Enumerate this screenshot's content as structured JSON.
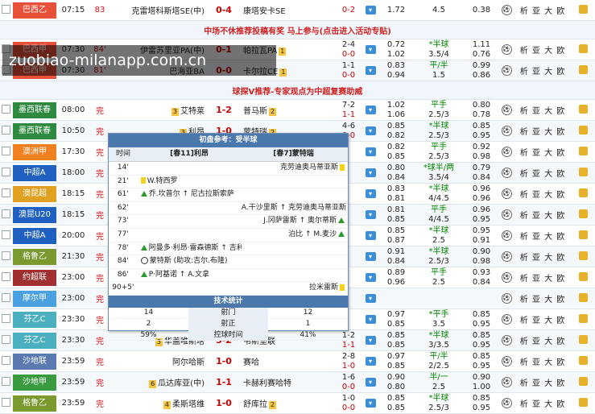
{
  "watermark": "zuobiao-milanapp.com.cn",
  "promo1": "中场不休推荐投稿有奖 马上参与(点击进入活动专贴)",
  "promo2": "球探V推荐-专家观点为中超复赛助威",
  "links_label": "析 亚 大 欧",
  "top_rows": [
    {
      "league": "巴西乙",
      "league_color": "#e8503a",
      "time": "07:15",
      "status": "83",
      "home": "克雷塔科斯塔SE(中)",
      "score": "0-4",
      "away": "康塔安卡SE",
      "half": "0-2",
      "o1": "1.72",
      "o2": "4.5",
      "o3": "0.38"
    }
  ],
  "mid_rows": [
    {
      "league": "巴西甲",
      "league_color": "#e8503a",
      "time": "07:30",
      "status": "84'",
      "home": "伊雷苏里亚PA(中)",
      "home_rank": "",
      "score": "0-1",
      "away": "帕拉瓦PA",
      "away_rank": "1",
      "half_a": "2-4",
      "half_b": "0-0",
      "oa1": "0.72",
      "oa2": "*半球",
      "oa3": "1.11",
      "ob1": "1.02",
      "ob2": "3.5/4",
      "ob3": "0.76"
    },
    {
      "league": "巴西甲",
      "league_color": "#e8503a",
      "time": "07:30",
      "status": "81'",
      "home": "巴海亚BA",
      "home_rank": "",
      "score": "0-0",
      "away": "卡尔拉CE",
      "away_rank": "1",
      "half_a": "1-1",
      "half_b": "0-0",
      "oa1": "0.83",
      "oa2": "平/半",
      "oa3": "0.99",
      "ob1": "0.94",
      "ob2": "1.5",
      "ob3": "0.86"
    }
  ],
  "rows": [
    {
      "league": "墨西联春",
      "league_color": "#2d8a3e",
      "time": "08:00",
      "status": "完",
      "home": "艾特莱",
      "home_rank": "3",
      "score": "1-2",
      "away": "普马斯",
      "away_rank": "2",
      "half_a": "7-2",
      "half_b": "1-1",
      "oa1": "1.02",
      "oa2": "平手",
      "oa3": "0.80",
      "ob1": "1.06",
      "ob2": "2.5/3",
      "ob3": "0.78"
    },
    {
      "league": "墨西联春",
      "league_color": "#2d8a3e",
      "time": "10:50",
      "status": "完",
      "home": "利昂",
      "home_rank": "3",
      "score": "1-0",
      "away": "蒙特瑞",
      "away_rank": "2",
      "half_a": "4-6",
      "half_b": "0-0",
      "oa1": "0.85",
      "oa2": "*半球",
      "oa3": "0.85",
      "ob1": "0.82",
      "ob2": "2.5/3",
      "ob3": "0.95"
    },
    {
      "league": "澳洲甲",
      "league_color": "#f08020",
      "time": "17:30",
      "status": "完",
      "home": "",
      "home_rank": "",
      "score": "",
      "away": "",
      "away_rank": "",
      "half_a": "",
      "half_b": "",
      "oa1": "0.82",
      "oa2": "平手",
      "oa3": "0.92",
      "ob1": "0.85",
      "ob2": "2.5/3",
      "ob3": "0.98"
    },
    {
      "league": "中超A",
      "league_color": "#2060c0",
      "time": "18:00",
      "status": "完",
      "home": "",
      "home_rank": "",
      "score": "",
      "away": "",
      "away_rank": "",
      "half_a": "",
      "half_b": "",
      "oa1": "0.80",
      "oa2": "*球半/两",
      "oa3": "0.79",
      "ob1": "0.84",
      "ob2": "3.5/4",
      "ob3": "0.84"
    },
    {
      "league": "澳昆超",
      "league_color": "#e0a020",
      "time": "18:15",
      "status": "完",
      "home": "",
      "home_rank": "",
      "score": "",
      "away": "",
      "away_rank": "",
      "half_a": "",
      "half_b": "",
      "oa1": "0.83",
      "oa2": "*半球",
      "oa3": "0.96",
      "ob1": "0.81",
      "ob2": "4/4.5",
      "ob3": "0.96"
    },
    {
      "league": "澳昆U20",
      "league_color": "#2060c0",
      "time": "18:15",
      "status": "完",
      "home": "",
      "home_rank": "",
      "score": "",
      "away": "",
      "away_rank": "",
      "half_a": "",
      "half_b": "",
      "oa1": "0.81",
      "oa2": "平手",
      "oa3": "0.96",
      "ob1": "0.85",
      "ob2": "4/4.5",
      "ob3": "0.95"
    },
    {
      "league": "中超A",
      "league_color": "#2060c0",
      "time": "20:00",
      "status": "完",
      "home": "",
      "home_rank": "",
      "score": "",
      "away": "",
      "away_rank": "",
      "half_a": "",
      "half_b": "",
      "oa1": "0.85",
      "oa2": "*半球",
      "oa3": "0.95",
      "ob1": "0.87",
      "ob2": "2.5",
      "ob3": "0.91"
    },
    {
      "league": "格鲁乙",
      "league_color": "#7a9a30",
      "time": "21:30",
      "status": "完",
      "home": "",
      "home_rank": "",
      "score": "",
      "away": "",
      "away_rank": "",
      "half_a": "",
      "half_b": "",
      "oa1": "0.91",
      "oa2": "*半球",
      "oa3": "0.90",
      "ob1": "0.84",
      "ob2": "2.5/3",
      "ob3": "0.98"
    },
    {
      "league": "约超联",
      "league_color": "#a03030",
      "time": "23:00",
      "status": "完",
      "home": "",
      "home_rank": "",
      "score": "",
      "away": "",
      "away_rank": "",
      "half_a": "",
      "half_b": "",
      "oa1": "0.89",
      "oa2": "平手",
      "oa3": "0.93",
      "ob1": "0.96",
      "ob2": "2.5",
      "ob3": "0.84"
    },
    {
      "league": "摩尔甲",
      "league_color": "#4aa0e0",
      "time": "23:00",
      "status": "完",
      "home": "",
      "home_rank": "",
      "score": "",
      "away": "",
      "away_rank": "",
      "half_a": "",
      "half_b": "",
      "oa1": "",
      "oa2": "",
      "oa3": "",
      "ob1": "",
      "ob2": "",
      "ob3": ""
    },
    {
      "league": "芬乙C",
      "league_color": "#4ab0c0",
      "time": "23:30",
      "status": "完",
      "home": "",
      "home_rank": "",
      "score": "",
      "away": "",
      "away_rank": "",
      "half_a": "",
      "half_b": "",
      "oa1": "0.97",
      "oa2": "*平手",
      "oa3": "0.85",
      "ob1": "0.85",
      "ob2": "3.5",
      "ob3": "0.95"
    },
    {
      "league": "芬乙C",
      "league_color": "#4ab0c0",
      "time": "23:30",
      "status": "完",
      "home": "华盖唯斯塔",
      "home_rank": "3",
      "score": "3-2",
      "away": "韦斯堡联",
      "away_rank": "",
      "half_a": "1-2",
      "half_b": "1-1",
      "oa1": "0.85",
      "oa2": "*半球",
      "oa3": "0.85",
      "ob1": "0.85",
      "ob2": "3/3.5",
      "ob3": "0.95"
    },
    {
      "league": "沙地联",
      "league_color": "#5a7ab0",
      "time": "23:59",
      "status": "完",
      "home": "阿尔哈斯",
      "home_rank": "",
      "score": "1-0",
      "away": "赛哈",
      "away_rank": "",
      "half_a": "2-8",
      "half_b": "1-0",
      "oa1": "0.97",
      "oa2": "平/半",
      "oa3": "0.85",
      "ob1": "0.85",
      "ob2": "2/2.5",
      "ob3": "0.95"
    },
    {
      "league": "沙地甲",
      "league_color": "#3a9a40",
      "time": "23:59",
      "status": "完",
      "home": "瓜达库亚(中)",
      "home_rank": "6",
      "score": "1-1",
      "away": "卡赫利赛哈特",
      "away_rank": "",
      "half_a": "1-6",
      "half_b": "0-0",
      "oa1": "0.90",
      "oa2": "半/一",
      "oa3": "0.90",
      "ob1": "0.80",
      "ob2": "2.5",
      "ob3": "1.00"
    },
    {
      "league": "格鲁乙",
      "league_color": "#7a9a30",
      "time": "23:59",
      "status": "完",
      "home": "柔斯塔维",
      "home_rank": "4",
      "score": "1-0",
      "away": "舒库拉",
      "away_rank": "2",
      "half_a": "1-0",
      "half_b": "0-0",
      "oa1": "0.85",
      "oa2": "*半球",
      "oa3": "0.85",
      "ob1": "0.85",
      "ob2": "2.5/3",
      "ob3": "0.95"
    }
  ],
  "popup": {
    "title": "初盘参考：受半球",
    "col_time": "时间",
    "home": "[春11]利昂",
    "away": "[春7]蒙特瑞",
    "events": [
      {
        "t": "14'",
        "h": "",
        "hi": "",
        "a": "克劳迪奥马蒂亚斯",
        "ai": "yc"
      },
      {
        "t": "21'",
        "h": "W.特西罗",
        "hi": "yc",
        "a": "",
        "ai": ""
      },
      {
        "t": "61'",
        "h": "乔.坎普尔 ↑ 尼古拉斯索萨",
        "hi": "up",
        "a": "",
        "ai": ""
      },
      {
        "t": "62'",
        "h": "",
        "hi": "",
        "a": "A.干沙里斯 ↑ 克劳迪奥马蒂亚斯",
        "ai": "up"
      },
      {
        "t": "73'",
        "h": "",
        "hi": "",
        "a": "J.冈萨雷斯 ↑ 奥尔蒂斯",
        "ai": "up"
      },
      {
        "t": "77'",
        "h": "",
        "hi": "",
        "a": "泊比 ↑ M.麦沙",
        "ai": "up"
      },
      {
        "t": "78'",
        "h": "阿曼多·利昂·雷森德斯 ↑ 吉利奥蒂",
        "hi": "up",
        "a": "",
        "ai": ""
      },
      {
        "t": "84'",
        "h": "蒙特斯 (助攻:吉尔.布隆)",
        "hi": "goal",
        "a": "",
        "ai": ""
      },
      {
        "t": "86'",
        "h": "P·阿基诺 ↑ A.文拿",
        "hi": "up",
        "a": "",
        "ai": ""
      },
      {
        "t": "90+5'",
        "h": "",
        "hi": "",
        "a": "拉米雷斯",
        "ai": "yc"
      }
    ],
    "stats_title": "技术统计",
    "stats": [
      {
        "h": "14",
        "label": "射门",
        "a": "12"
      },
      {
        "h": "2",
        "label": "射正",
        "a": "1"
      },
      {
        "h": "59%",
        "label": "控球时间",
        "a": "41%"
      }
    ]
  }
}
